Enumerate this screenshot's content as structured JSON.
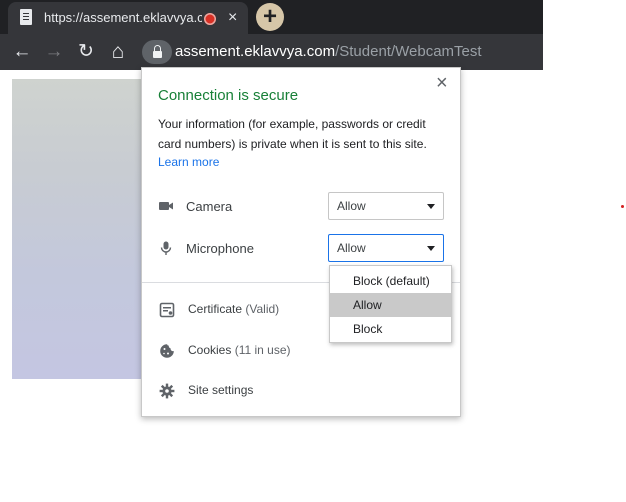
{
  "browser": {
    "tab_title": "https://assement.eklavvya.com/Student/WebcamTest",
    "tab_close": "×",
    "new_tab": "+",
    "nav": {
      "back": "←",
      "forward": "→",
      "reload": "↻",
      "home": "⌂"
    },
    "url_host": "assement.eklavvya.com",
    "url_path": "/Student/WebcamTest"
  },
  "popup": {
    "heading": "Connection is secure",
    "close": "×",
    "description": "Your information (for example, passwords or credit card numbers) is private when it is sent to this site.",
    "learn_more": "Learn more",
    "permissions": [
      {
        "label": "Camera",
        "value": "Allow",
        "icon": "camera-icon"
      },
      {
        "label": "Microphone",
        "value": "Allow",
        "icon": "microphone-icon"
      }
    ],
    "items": [
      {
        "label": "Certificate",
        "sub": " (Valid)",
        "icon": "certificate-icon"
      },
      {
        "label": "Cookies",
        "sub": " (11 in use)",
        "icon": "cookie-icon"
      },
      {
        "label": "Site settings",
        "sub": "",
        "icon": "gear-icon"
      }
    ]
  },
  "dropdown": {
    "options": [
      "Block (default)",
      "Allow",
      "Block"
    ],
    "selected": "Allow"
  },
  "colors": {
    "secure_green": "#188038",
    "link_blue": "#1a73e8",
    "focus_blue": "#1a73e8"
  }
}
